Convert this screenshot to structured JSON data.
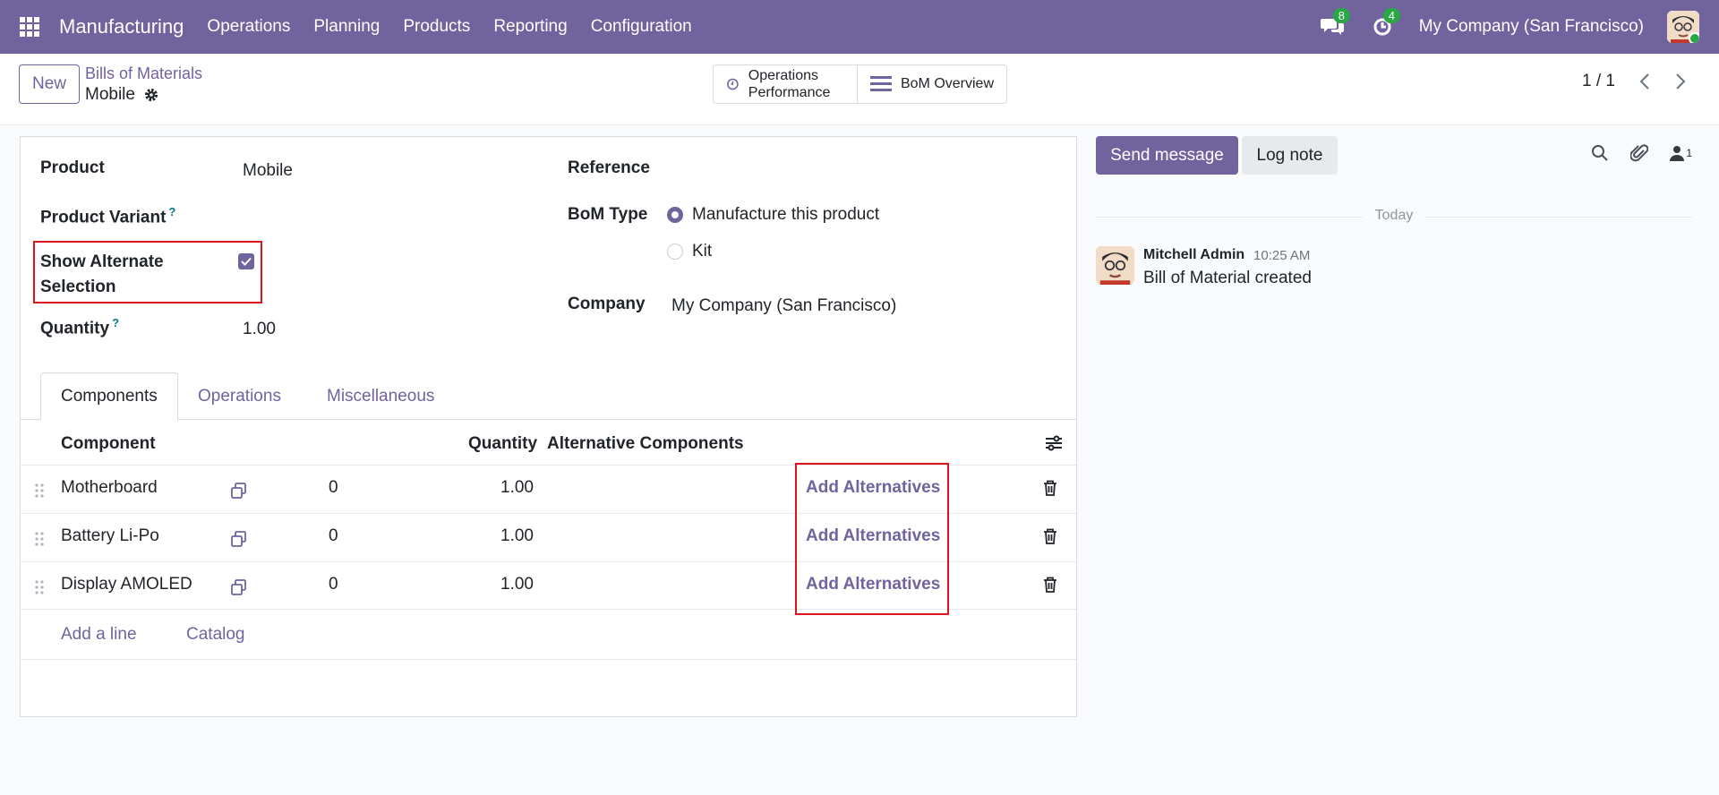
{
  "topbar": {
    "app": "Manufacturing",
    "menu": [
      "Operations",
      "Planning",
      "Products",
      "Reporting",
      "Configuration"
    ],
    "messages_count": "8",
    "activities_count": "4",
    "company": "My Company (San Francisco)"
  },
  "control": {
    "new_label": "New",
    "breadcrumb_parent": "Bills of Materials",
    "record_name": "Mobile",
    "smart_buttons": [
      "Operations Performance",
      "BoM Overview"
    ],
    "pager": "1 / 1"
  },
  "form": {
    "product_label": "Product",
    "product_value": "Mobile",
    "variant_label": "Product Variant",
    "help_mark": "?",
    "alt_label": "Show Alternate Selection",
    "alt_checked": true,
    "quantity_label": "Quantity",
    "quantity_value": "1.00",
    "reference_label": "Reference",
    "bomtype_label": "BoM Type",
    "bomtype_options": [
      "Manufacture this product",
      "Kit"
    ],
    "bomtype_selected": "Manufacture this product",
    "company_label": "Company",
    "company_value": "My Company (San Francisco)"
  },
  "tabs": [
    "Components",
    "Operations",
    "Miscellaneous"
  ],
  "components_table": {
    "headers": [
      "Component",
      "Quantity",
      "Alternative Components"
    ],
    "rows": [
      {
        "component": "Motherboard",
        "count": "0",
        "quantity": "1.00",
        "action": "Add Alternatives"
      },
      {
        "component": "Battery Li-Po",
        "count": "0",
        "quantity": "1.00",
        "action": "Add Alternatives"
      },
      {
        "component": "Display AMOLED",
        "count": "0",
        "quantity": "1.00",
        "action": "Add Alternatives"
      }
    ],
    "add_line": "Add a line",
    "catalog": "Catalog"
  },
  "chatter": {
    "send_label": "Send message",
    "log_label": "Log note",
    "followers_count": "1",
    "date_separator": "Today",
    "messages": [
      {
        "author": "Mitchell Admin",
        "time": "10:25 AM",
        "body": "Bill of Material created"
      }
    ]
  },
  "colors": {
    "brand": "#71639e",
    "highlight": "#e0121b",
    "badge": "#28a745"
  }
}
